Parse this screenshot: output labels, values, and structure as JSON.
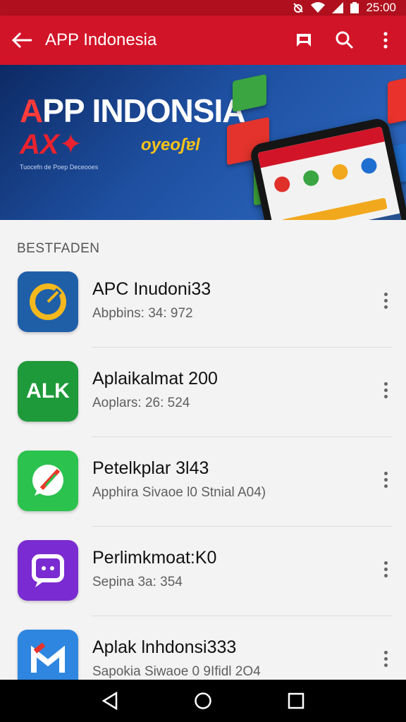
{
  "status_bar": {
    "time": "25:00"
  },
  "app_bar": {
    "title": "APP Indonesia"
  },
  "banner": {
    "title_part1": "A",
    "title_part2": "PP INDONSIA",
    "logo_text": "AX✦",
    "brand_text": "oyeoʃɐl",
    "tagline": "Tuocefn de Poep Deceooes",
    "page_count": 2,
    "active_page": 1
  },
  "section": {
    "title": "BESTFADEN"
  },
  "apps": [
    {
      "name": "APC Inudoni33",
      "sub": "Abpbins: 34: 972",
      "icon_name": "gauge-icon",
      "icon_bg": "#1f5fa8",
      "icon_text": ""
    },
    {
      "name": "Aplaikalmat 200",
      "sub": "Aoplars: 26: 524",
      "icon_name": "alk-logo-icon",
      "icon_bg": "#1e9a3a",
      "icon_text": "ALK"
    },
    {
      "name": "Petelkplar 3l43",
      "sub": "Apphira Sivaoe l0 Stnial A04)",
      "icon_name": "whatsapp-style-icon",
      "icon_bg": "#2bc24e",
      "icon_text": ""
    },
    {
      "name": "Perlimkmoat:K0",
      "sub": "Sepina 3a: 354",
      "icon_name": "chat-bubble-icon",
      "icon_bg": "#7a2bd1",
      "icon_text": ""
    },
    {
      "name": "Aplak lnhdonsi333",
      "sub": "Sapokia Siwaoe 0 9Ifidl 2O4",
      "icon_name": "m-logo-icon",
      "icon_bg": "#2f86e0",
      "icon_text": ""
    }
  ],
  "colors": {
    "primary": "#d21428",
    "status": "#b0101e",
    "background": "#f3f3f3"
  }
}
